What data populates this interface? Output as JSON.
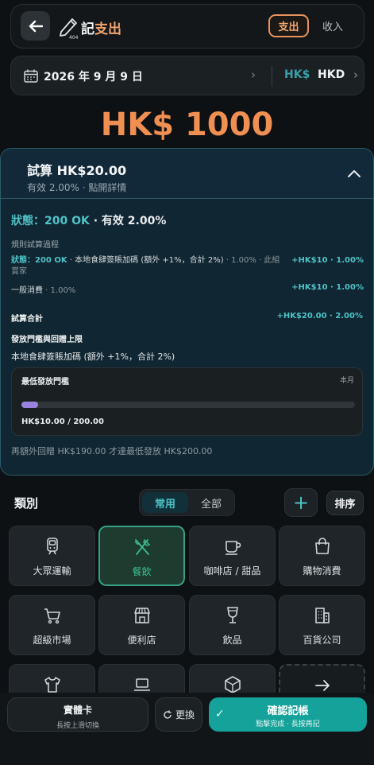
{
  "header": {
    "title_prefix": "記",
    "title_accent": "支出",
    "pencil_badge": "404",
    "seg_expense": "支出",
    "seg_income": "收入"
  },
  "datebar": {
    "date": "2026 年 9 月 9 日",
    "chevron": "›",
    "currency_symbol": "HK$",
    "currency_code": "HKD",
    "currency_chevron": "›"
  },
  "amount": "HK$ 1000",
  "calc": {
    "title": "試算 HK$20.00",
    "subtitle": "有效 2.00% · 點開詳情",
    "status_label": "狀態：",
    "status_ok": "200 OK",
    "status_rest": " · 有效 2.00%",
    "process_label": "規則試算過程",
    "rule1_ok": "狀態：200 OK",
    "rule1_text": " · 本地食肆簽賬加碼 (額外 +1%，合計 2%)",
    "rule1_muted": " · 1.00% · 此組賞家",
    "rule1_amount": "+HK$10 · 1.00%",
    "rule2_text": "一般消費",
    "rule2_muted": " · 1.00%",
    "rule2_amount": "+HK$10 · 1.00%",
    "total_label": "試算合計",
    "total_value": "+HK$20.00 · 2.00%",
    "cap_title": "發放門檻與回贈上限",
    "cap_desc": "本地食肆簽賬加碼 (額外 +1%，合計 2%)",
    "min_title": "最低發放門檻",
    "min_period": "本月",
    "min_progress": 0.05,
    "min_value": "HK$10.00 / 200.00",
    "remain_text": "再額外回贈 HK$190.00 才達最低發放 HK$200.00"
  },
  "category": {
    "heading": "類別",
    "tab_common": "常用",
    "tab_all": "全部",
    "add": "+",
    "sort": "排序",
    "items": [
      {
        "label": "大眾運輸",
        "icon": "train-icon"
      },
      {
        "label": "餐飲",
        "icon": "utensils-icon",
        "selected": true
      },
      {
        "label": "咖啡店 / 甜品",
        "icon": "coffee-cup-icon"
      },
      {
        "label": "購物消費",
        "icon": "shopping-bag-icon"
      },
      {
        "label": "超級市場",
        "icon": "shopping-cart-icon"
      },
      {
        "label": "便利店",
        "icon": "storefront-icon"
      },
      {
        "label": "飲品",
        "icon": "wine-glass-icon"
      },
      {
        "label": "百貨公司",
        "icon": "building-icon"
      },
      {
        "label": "",
        "icon": "tshirt-icon"
      },
      {
        "label": "",
        "icon": "laptop-icon"
      },
      {
        "label": "",
        "icon": "box-icon"
      },
      {
        "label": "",
        "icon": "arrow-right-icon"
      }
    ]
  },
  "bottom": {
    "card_title": "實體卡",
    "card_sub": "長按上滑切換",
    "swap": "更換",
    "confirm_title": "確認記帳",
    "confirm_sub": "點擊完成 · 長按再記"
  },
  "colors": {
    "accent_orange": "#f08f52",
    "accent_teal": "#4ec3c8",
    "confirm": "#14a29a",
    "selected": "#37a181"
  }
}
